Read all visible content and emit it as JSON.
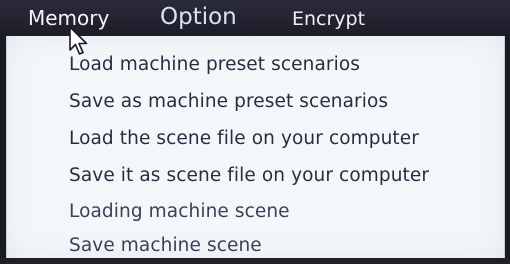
{
  "menubar": {
    "items": [
      {
        "label": "Memory"
      },
      {
        "label": "Option"
      },
      {
        "label": "Encrypt"
      }
    ]
  },
  "dropdown": {
    "items": [
      {
        "label": "Load machine preset scenarios"
      },
      {
        "label": "Save as machine preset scenarios"
      },
      {
        "label": "Load the scene file on your computer"
      },
      {
        "label": "Save it as scene file on your computer"
      },
      {
        "label": "Loading machine scene"
      },
      {
        "label": "Save machine scene"
      }
    ]
  },
  "icons": {
    "cursor": "mouse-pointer-icon"
  },
  "colors": {
    "menubar_background": "#1d1d28",
    "menu_text": "#e8ecf5",
    "dropdown_background": "#f4f7fa",
    "option_text": "#2b2b40"
  }
}
